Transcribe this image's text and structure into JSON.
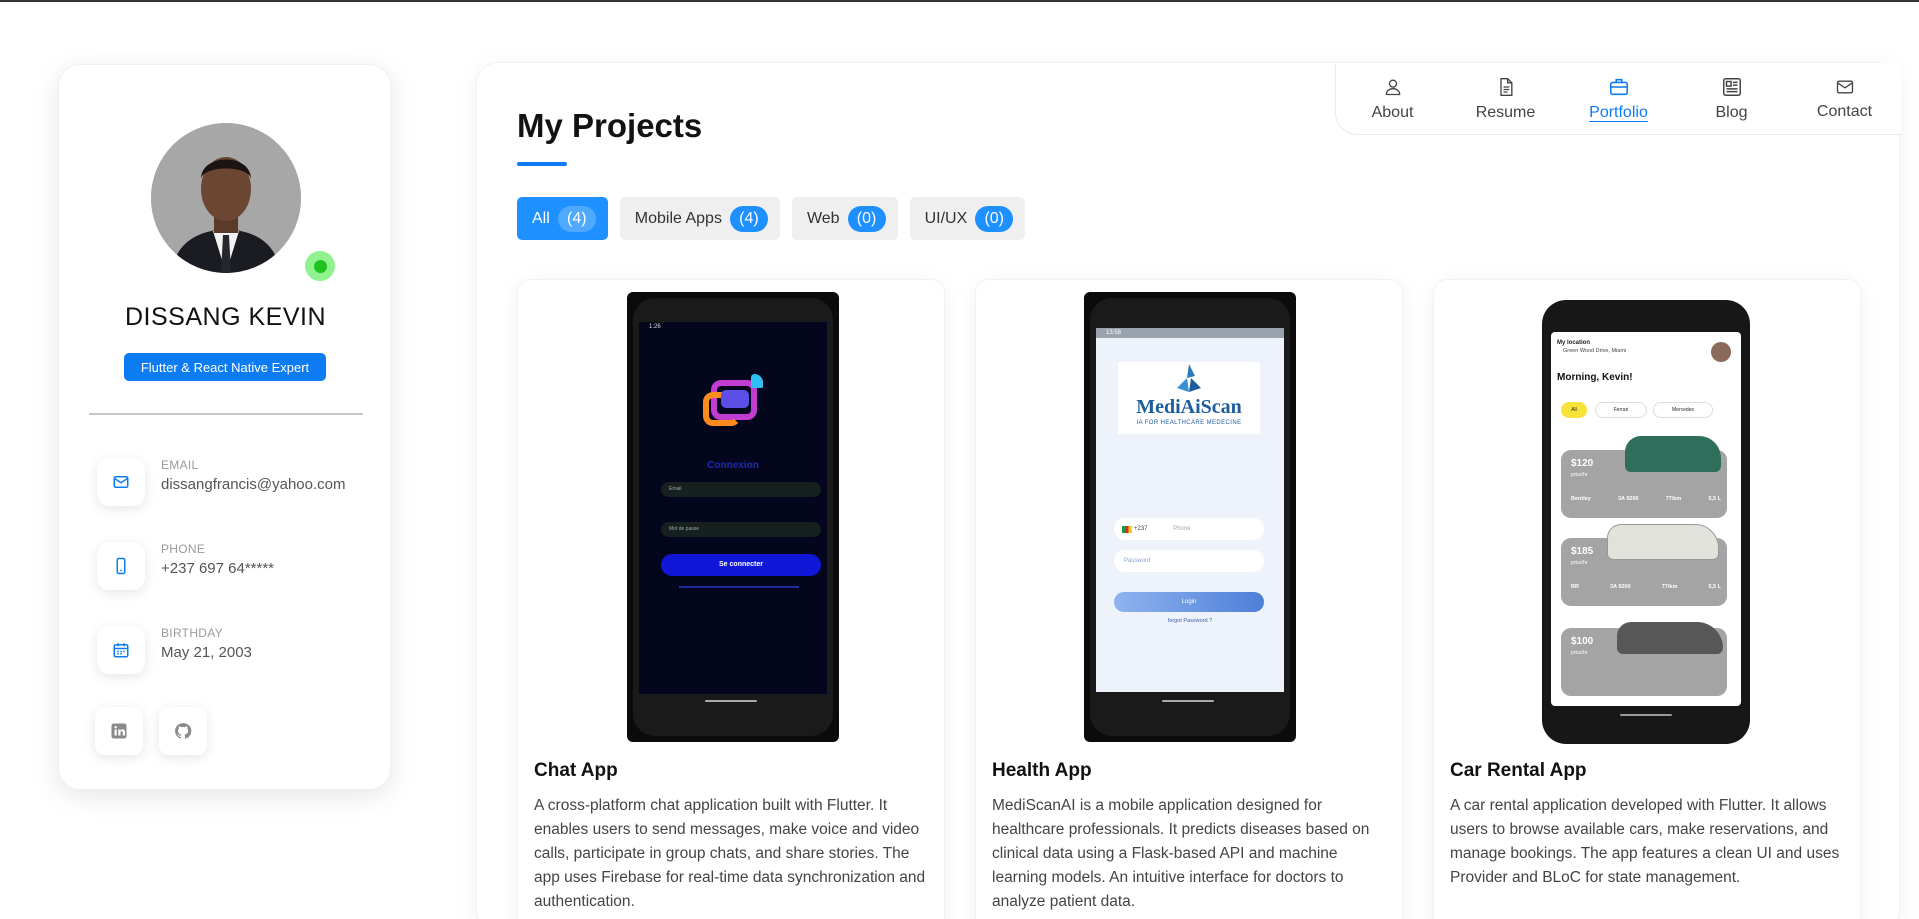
{
  "profile": {
    "name": "DISSANG KEVIN",
    "role": "Flutter & React Native Expert",
    "contacts": [
      {
        "label": "EMAIL",
        "value": "dissangfrancis@yahoo.com",
        "icon": "mail-icon"
      },
      {
        "label": "PHONE",
        "value": "+237 697 64*****",
        "icon": "phone-icon"
      },
      {
        "label": "BIRTHDAY",
        "value": "May 21, 2003",
        "icon": "calendar-icon"
      }
    ],
    "social": [
      "linkedin-icon",
      "github-icon"
    ]
  },
  "nav": [
    {
      "label": "About",
      "icon": "user-icon"
    },
    {
      "label": "Resume",
      "icon": "document-icon"
    },
    {
      "label": "Portfolio",
      "icon": "briefcase-icon",
      "active": true
    },
    {
      "label": "Blog",
      "icon": "newspaper-icon"
    },
    {
      "label": "Contact",
      "icon": "envelope-icon"
    }
  ],
  "page_title": "My Projects",
  "filters": [
    {
      "label": "All",
      "count": "(4)",
      "active": true
    },
    {
      "label": "Mobile Apps",
      "count": "(4)"
    },
    {
      "label": "Web",
      "count": "(0)"
    },
    {
      "label": "UI/UX",
      "count": "(0)"
    }
  ],
  "projects": [
    {
      "title": "Chat App",
      "description": "A cross-platform chat application built with Flutter. It enables users to send messages, make voice and video calls, participate in group chats, and share stories. The app uses Firebase for real-time data synchronization and authentication.",
      "screen": {
        "time": "1:26",
        "heading": "Connexion",
        "email": "Email",
        "password": "Mot de passe",
        "button": "Se connecter"
      }
    },
    {
      "title": "Health App",
      "description": "MediScanAI is a mobile application designed for healthcare professionals. It predicts diseases based on clinical data using a Flask-based API and machine learning models. An intuitive interface for doctors to analyze patient data.",
      "screen": {
        "time": "13:58",
        "brand": "MediAiScan",
        "tagline": "IA FOR HEALTHCARE MEDECINE",
        "code": "+237",
        "phone": "Phone",
        "password": "Password",
        "button": "Login",
        "forgot": "forgot Password ?"
      }
    },
    {
      "title": "Car Rental App",
      "description": "A car rental application developed with Flutter. It allows users to browse available cars, make reservations, and manage bookings. The app features a clean UI and uses Provider and BLoC for state management.",
      "screen": {
        "location_label": "My location",
        "location": "Green Wood Drive, Miami",
        "greeting": "Morning, Kevin!",
        "tabs": [
          "All",
          "Ferrari",
          "Mercedes"
        ],
        "cars": [
          {
            "price": "$120",
            "unit": "price/hr",
            "specs": [
              "Bentley",
              "3A 9200",
              "77/km",
              "5,5 L"
            ],
            "color": "#2f6e5a"
          },
          {
            "price": "$185",
            "unit": "price/hr",
            "specs": [
              "RR",
              "3A 9200",
              "77/km",
              "5,5 L"
            ],
            "color": "#d8d8d2"
          },
          {
            "price": "$100",
            "unit": "price/hr",
            "specs": [],
            "color": "#555"
          }
        ]
      }
    }
  ]
}
